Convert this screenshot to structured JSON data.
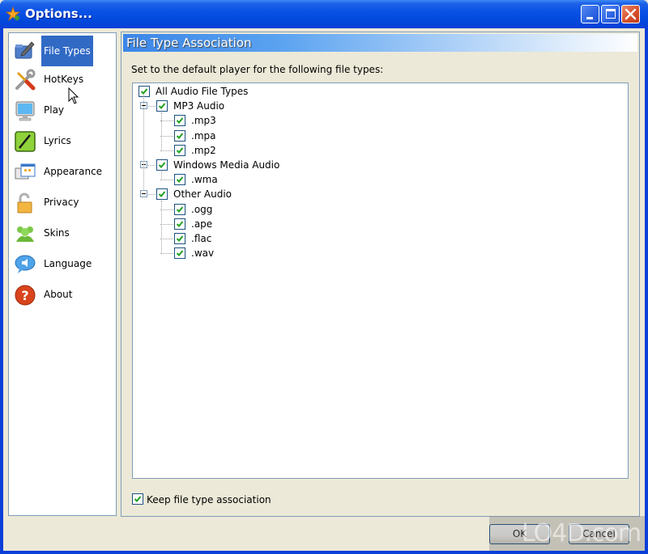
{
  "window": {
    "title": "Options...",
    "colors": {
      "titlebar": "#0A52E6",
      "selection": "#316AC5",
      "face": "#ECE9D8",
      "border": "#7F9DB9"
    }
  },
  "sidebar": {
    "selected": "File Types",
    "items": [
      {
        "label": "File Types",
        "icon": "file-types-icon"
      },
      {
        "label": "HotKeys",
        "icon": "tools-icon"
      },
      {
        "label": "Play",
        "icon": "monitor-icon"
      },
      {
        "label": "Lyrics",
        "icon": "pen-icon"
      },
      {
        "label": "Appearance",
        "icon": "window-icon"
      },
      {
        "label": "Privacy",
        "icon": "lock-icon"
      },
      {
        "label": "Skins",
        "icon": "users-icon"
      },
      {
        "label": "Language",
        "icon": "speech-bubble-icon"
      },
      {
        "label": "About",
        "icon": "question-icon"
      }
    ]
  },
  "panel": {
    "header": "File Type Association",
    "description": "Set to the default player for the following file types:",
    "tree": [
      {
        "label": "All Audio File Types",
        "checked": true,
        "level": 0
      },
      {
        "label": "MP3 Audio",
        "checked": true,
        "level": 1,
        "expanded": true
      },
      {
        "label": ".mp3",
        "checked": true,
        "level": 2
      },
      {
        "label": ".mpa",
        "checked": true,
        "level": 2
      },
      {
        "label": ".mp2",
        "checked": true,
        "level": 2
      },
      {
        "label": "Windows Media Audio",
        "checked": true,
        "level": 1,
        "expanded": true
      },
      {
        "label": ".wma",
        "checked": true,
        "level": 2
      },
      {
        "label": "Other Audio",
        "checked": true,
        "level": 1,
        "expanded": true
      },
      {
        "label": ".ogg",
        "checked": true,
        "level": 2
      },
      {
        "label": ".ape",
        "checked": true,
        "level": 2
      },
      {
        "label": ".flac",
        "checked": true,
        "level": 2
      },
      {
        "label": ".wav",
        "checked": true,
        "level": 2
      }
    ],
    "keep_association": {
      "label": "Keep file type association",
      "checked": true
    }
  },
  "buttons": {
    "ok": "OK",
    "cancel": "Cancel"
  },
  "watermark": "LO4D.com"
}
